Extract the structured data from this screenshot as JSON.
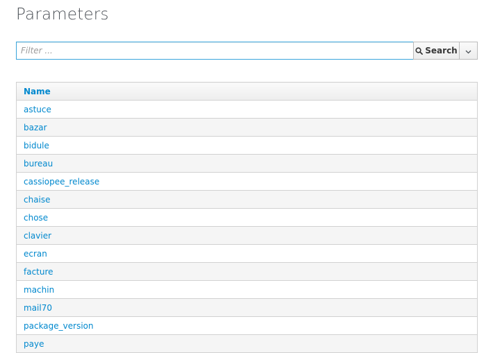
{
  "page": {
    "title": "Parameters"
  },
  "search": {
    "placeholder": "Filter ...",
    "value": "",
    "button_label": "Search",
    "button_icon": "search-icon",
    "dropdown_icon": "chevron-down-icon"
  },
  "table": {
    "columns": [
      "Name"
    ],
    "rows": [
      "astuce",
      "bazar",
      "bidule",
      "bureau",
      "cassiopee_release",
      "chaise",
      "chose",
      "clavier",
      "ecran",
      "facture",
      "machin",
      "mail70",
      "package_version",
      "paye"
    ]
  },
  "colors": {
    "link": "#0088ce",
    "input_focus_border": "#39a5dc",
    "row_stripe": "#f5f5f5",
    "border": "#d1d1d1"
  }
}
